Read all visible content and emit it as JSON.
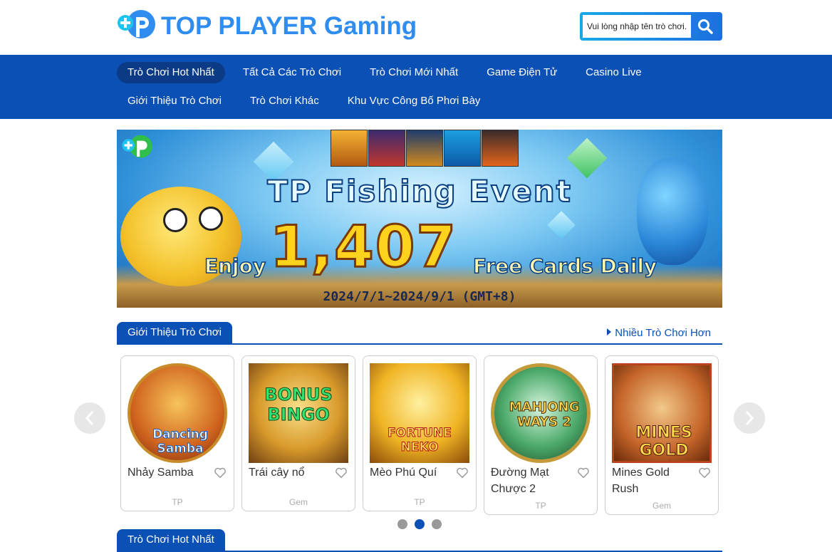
{
  "brand": {
    "name": "TOP PLAYER Gaming"
  },
  "search": {
    "placeholder": "Vui lòng nhập tên trò chơi."
  },
  "nav": {
    "row1": [
      "Trò Chơi Hot Nhất",
      "Tất Cả Các Trò Chơi",
      "Trò Chơi Mới Nhất",
      "Game Điện Tử",
      "Casino Live"
    ],
    "row2": [
      "Giới Thiệu Trò Chơi",
      "Trò Chơi Khác",
      "Khu Vực Công Bố Phơi Bày"
    ],
    "active": "Trò Chơi Hot Nhất"
  },
  "banner": {
    "title": "TP Fishing Event",
    "enjoy": "Enjoy",
    "amount": "1,407",
    "free": "Free Cards Daily",
    "dates": "2024/7/1~2024/9/1 (GMT+8)"
  },
  "section_intro": {
    "title": "Giới Thiệu Trò Chơi",
    "more": "Nhiều Trò Chơi Hơn"
  },
  "games": [
    {
      "name": "Nhảy Samba",
      "provider": "TP",
      "art_text": "Dancing Samba"
    },
    {
      "name": "Trái cây nổ",
      "provider": "Gem",
      "art_text": "BONUS BINGO"
    },
    {
      "name": "Mèo Phú Quí",
      "provider": "TP",
      "art_text": "FORTUNE NEKO"
    },
    {
      "name": "Đường Mạt Chược 2",
      "provider": "TP",
      "art_text": "MAHJONG WAYS 2"
    },
    {
      "name": "Mines Gold Rush",
      "provider": "Gem",
      "art_text": "MINES GOLD RUSH"
    }
  ],
  "carousel": {
    "page_count": 3,
    "active_page": 2
  },
  "section_hot": {
    "title": "Trò Chơi Hot Nhất"
  },
  "colors": {
    "brand_blue": "#0a50b5",
    "logo_blue": "#2f8df0",
    "nav_active": "#0b3a86"
  }
}
